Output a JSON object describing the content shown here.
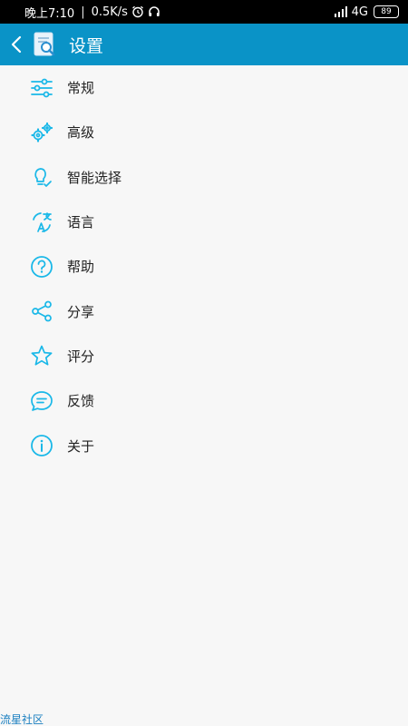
{
  "status_bar": {
    "time": "晚上7:10",
    "speed": "0.5K/s",
    "network": "4G",
    "battery": "89"
  },
  "header": {
    "title": "设置"
  },
  "menu": {
    "items": [
      {
        "label": "常规",
        "icon": "sliders-icon"
      },
      {
        "label": "高级",
        "icon": "gears-icon"
      },
      {
        "label": "智能选择",
        "icon": "lightbulb-icon"
      },
      {
        "label": "语言",
        "icon": "translate-icon"
      },
      {
        "label": "帮助",
        "icon": "help-icon"
      },
      {
        "label": "分享",
        "icon": "share-icon"
      },
      {
        "label": "评分",
        "icon": "star-icon"
      },
      {
        "label": "反馈",
        "icon": "chat-icon"
      },
      {
        "label": "关于",
        "icon": "info-icon"
      }
    ]
  },
  "watermark": "流星社区",
  "colors": {
    "header": "#0a93c7",
    "icon": "#1ab8e8",
    "background": "#f7f7f7"
  }
}
